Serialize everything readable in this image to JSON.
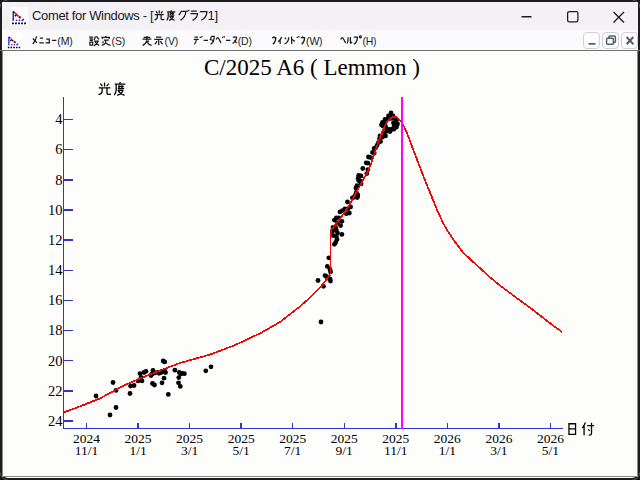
{
  "window": {
    "title": "Comet for Windows - [光度グラフ1]",
    "app_icon": "comet-lightcurve-icon",
    "controls": {
      "minimize": "minimize",
      "maximize": "maximize",
      "close": "close"
    }
  },
  "menu_bar": {
    "items": [
      {
        "label": "ﾒﾆｭｰ(M)"
      },
      {
        "label": "設定(S)"
      },
      {
        "label": "表示(V)"
      },
      {
        "label": "ﾃﾞｰﾀﾍﾞｰｽ(D)"
      },
      {
        "label": "ｳｨﾝﾄﾞｳ(W)"
      },
      {
        "label": "ﾍﾙﾌﾟ(H)"
      }
    ],
    "mdi_controls": {
      "minimize": "minimize",
      "restore": "restore",
      "close": "close"
    }
  },
  "chart_data": {
    "type": "scatter",
    "title": "C/2025 A6 ( Lemmon )",
    "xlabel": "日付",
    "ylabel": "光度",
    "x_ticks": [
      {
        "year": "2024",
        "date": "11/1"
      },
      {
        "year": "2025",
        "date": "1/1"
      },
      {
        "year": "2025",
        "date": "3/1"
      },
      {
        "year": "2025",
        "date": "5/1"
      },
      {
        "year": "2025",
        "date": "7/1"
      },
      {
        "year": "2025",
        "date": "9/1"
      },
      {
        "year": "2025",
        "date": "11/1"
      },
      {
        "year": "2026",
        "date": "1/1"
      },
      {
        "year": "2026",
        "date": "3/1"
      },
      {
        "year": "2026",
        "date": "5/1"
      }
    ],
    "y_ticks": [
      4,
      6,
      8,
      10,
      12,
      14,
      16,
      18,
      20,
      22,
      24
    ],
    "ylim": [
      4,
      24
    ],
    "y_inverted": true,
    "marker_line_x": 6.12,
    "model_curve": [
      [
        -0.446,
        23.43
      ],
      [
        -0.126,
        23.03
      ],
      [
        0.262,
        22.5
      ],
      [
        0.727,
        21.64
      ],
      [
        1.038,
        21.18
      ],
      [
        1.426,
        20.65
      ],
      [
        1.814,
        20.15
      ],
      [
        2.396,
        19.59
      ],
      [
        2.881,
        18.96
      ],
      [
        3.366,
        18.19
      ],
      [
        3.754,
        17.43
      ],
      [
        4.142,
        16.4
      ],
      [
        4.336,
        15.81
      ],
      [
        4.53,
        15.14
      ],
      [
        4.665,
        14.58
      ],
      [
        4.733,
        14.28
      ],
      [
        4.737,
        11.33
      ],
      [
        4.821,
        11.0
      ],
      [
        4.918,
        10.6
      ],
      [
        5.015,
        10.13
      ],
      [
        5.112,
        9.6
      ],
      [
        5.209,
        9.01
      ],
      [
        5.306,
        8.38
      ],
      [
        5.403,
        7.78
      ],
      [
        5.48,
        7.28
      ],
      [
        5.538,
        6.75
      ],
      [
        5.577,
        6.35
      ],
      [
        5.616,
        5.96
      ],
      [
        5.655,
        5.56
      ],
      [
        5.694,
        5.19
      ],
      [
        5.732,
        4.86
      ],
      [
        5.771,
        4.53
      ],
      [
        5.81,
        4.27
      ],
      [
        5.849,
        4.07
      ],
      [
        5.887,
        3.92
      ],
      [
        5.926,
        3.86
      ],
      [
        5.965,
        3.85
      ],
      [
        6.014,
        3.85
      ],
      [
        6.043,
        3.95
      ],
      [
        6.081,
        4.08
      ],
      [
        6.12,
        4.19
      ],
      [
        6.178,
        4.6
      ],
      [
        6.237,
        5.06
      ],
      [
        6.334,
        5.96
      ],
      [
        6.431,
        6.82
      ],
      [
        6.528,
        7.68
      ],
      [
        6.625,
        8.51
      ],
      [
        6.722,
        9.34
      ],
      [
        6.819,
        10.13
      ],
      [
        6.916,
        10.86
      ],
      [
        7.013,
        11.43
      ],
      [
        7.148,
        12.12
      ],
      [
        7.304,
        12.82
      ],
      [
        7.478,
        13.38
      ],
      [
        7.672,
        13.98
      ],
      [
        7.866,
        14.58
      ],
      [
        8.06,
        15.11
      ],
      [
        8.254,
        15.61
      ],
      [
        8.448,
        16.1
      ],
      [
        8.661,
        16.63
      ],
      [
        8.875,
        17.2
      ],
      [
        9.049,
        17.66
      ],
      [
        9.224,
        18.09
      ]
    ],
    "observations": [
      [
        0.184,
        22.34
      ],
      [
        0.456,
        23.6
      ],
      [
        0.572,
        23.1
      ],
      [
        0.514,
        21.44
      ],
      [
        0.572,
        21.97
      ],
      [
        0.854,
        21.68
      ],
      [
        0.921,
        21.64
      ],
      [
        0.844,
        22.17
      ],
      [
        0.999,
        21.34
      ],
      [
        1.057,
        21.11
      ],
      [
        1.038,
        20.85
      ],
      [
        1.077,
        21.34
      ],
      [
        1.115,
        20.78
      ],
      [
        1.154,
        20.71
      ],
      [
        1.251,
        20.98
      ],
      [
        1.271,
        20.88
      ],
      [
        1.29,
        20.65
      ],
      [
        1.28,
        21.51
      ],
      [
        1.319,
        21.61
      ],
      [
        1.319,
        20.81
      ],
      [
        1.377,
        20.78
      ],
      [
        1.406,
        20.83
      ],
      [
        1.445,
        20.78
      ],
      [
        1.474,
        20.73
      ],
      [
        1.488,
        20.02
      ],
      [
        1.517,
        20.08
      ],
      [
        1.517,
        20.68
      ],
      [
        1.532,
        20.78
      ],
      [
        1.503,
        21.16
      ],
      [
        1.465,
        21.46
      ],
      [
        1.587,
        22.23
      ],
      [
        1.715,
        20.63
      ],
      [
        1.8,
        20.78
      ],
      [
        1.827,
        20.88
      ],
      [
        1.856,
        20.83
      ],
      [
        1.899,
        20.86
      ],
      [
        1.79,
        21.12
      ],
      [
        1.785,
        21.46
      ],
      [
        1.82,
        21.7
      ],
      [
        2.314,
        20.67
      ],
      [
        2.415,
        20.4
      ],
      [
        4.549,
        17.43
      ],
      [
        4.7,
        13.17
      ],
      [
        4.671,
        13.74
      ],
      [
        4.724,
        13.95
      ],
      [
        4.735,
        14.11
      ],
      [
        4.627,
        14.35
      ],
      [
        4.656,
        14.41
      ],
      [
        4.685,
        14.51
      ],
      [
        4.724,
        14.58
      ],
      [
        4.733,
        14.71
      ],
      [
        4.491,
        14.68
      ],
      [
        4.597,
        15.06
      ],
      [
        4.772,
        11.42
      ],
      [
        4.782,
        11.16
      ],
      [
        4.784,
        11.7
      ],
      [
        4.809,
        10.67
      ],
      [
        4.809,
        12.28
      ],
      [
        4.832,
        11.16
      ],
      [
        4.832,
        12.16
      ],
      [
        4.846,
        10.53
      ],
      [
        4.846,
        11.33
      ],
      [
        4.846,
        11.75
      ],
      [
        4.859,
        11.95
      ],
      [
        4.869,
        10.86
      ],
      [
        4.869,
        11.53
      ],
      [
        4.894,
        10.53
      ],
      [
        4.918,
        10.13
      ],
      [
        4.929,
        11.04
      ],
      [
        4.954,
        10.75
      ],
      [
        4.954,
        11.62
      ],
      [
        4.966,
        10.04
      ],
      [
        5.015,
        9.92
      ],
      [
        5.04,
        10.25
      ],
      [
        5.063,
        9.47
      ],
      [
        5.075,
        9.92
      ],
      [
        5.1,
        10.21
      ],
      [
        5.123,
        9.8
      ],
      [
        5.158,
        9.19
      ],
      [
        5.197,
        9.14
      ],
      [
        5.214,
        9.03
      ],
      [
        5.226,
        8.54
      ],
      [
        5.234,
        8.84
      ],
      [
        5.247,
        8.39
      ],
      [
        5.253,
        9.17
      ],
      [
        5.259,
        9.07
      ],
      [
        5.263,
        9.01
      ],
      [
        5.271,
        7.89
      ],
      [
        5.28,
        7.71
      ],
      [
        5.28,
        8.05
      ],
      [
        5.315,
        8.09
      ],
      [
        5.325,
        7.74
      ],
      [
        5.325,
        8.27
      ],
      [
        5.36,
        7.25
      ],
      [
        5.426,
        6.87
      ],
      [
        5.437,
        7.59
      ],
      [
        5.459,
        6.9
      ],
      [
        5.459,
        7.32
      ],
      [
        5.47,
        6.49
      ],
      [
        5.515,
        6.53
      ],
      [
        5.548,
        6.18
      ],
      [
        5.581,
        5.92
      ],
      [
        5.581,
        6.22
      ],
      [
        5.907,
        3.57
      ],
      [
        5.858,
        3.77
      ],
      [
        5.946,
        3.77
      ],
      [
        5.79,
        4.0
      ],
      [
        5.849,
        3.97
      ],
      [
        5.907,
        3.93
      ],
      [
        5.965,
        3.93
      ],
      [
        6.014,
        4.03
      ],
      [
        6.004,
        4.2
      ],
      [
        6.033,
        4.3
      ],
      [
        5.984,
        4.33
      ],
      [
        6.014,
        4.5
      ],
      [
        5.965,
        4.46
      ],
      [
        5.955,
        4.23
      ],
      [
        5.742,
        4.2
      ],
      [
        5.781,
        4.3
      ],
      [
        5.752,
        4.43
      ],
      [
        5.8,
        4.46
      ],
      [
        5.723,
        4.36
      ],
      [
        5.82,
        4.63
      ],
      [
        5.868,
        4.66
      ],
      [
        5.917,
        4.66
      ],
      [
        5.965,
        4.63
      ],
      [
        5.829,
        4.76
      ],
      [
        5.887,
        4.8
      ],
      [
        5.781,
        4.9
      ],
      [
        5.8,
        5.09
      ],
      [
        5.742,
        5.16
      ],
      [
        5.694,
        5.09
      ],
      [
        5.684,
        5.29
      ],
      [
        5.703,
        5.46
      ],
      [
        5.664,
        5.53
      ],
      [
        5.635,
        5.72
      ],
      [
        5.606,
        5.89
      ]
    ],
    "colors": {
      "axis": "#3232cd",
      "curve": "#f00505",
      "marker_line": "#ff00ff",
      "points": "#000000"
    },
    "layout": {
      "x0": 86.5,
      "dx": 51.55,
      "y0": 119.5,
      "dy": 15.0775,
      "axis_x": 63.5,
      "axis_top": 97,
      "axis_bottom": 428.5,
      "axis_right": 563,
      "ytick_len": 9.5,
      "xtick_len": 5.5
    }
  }
}
